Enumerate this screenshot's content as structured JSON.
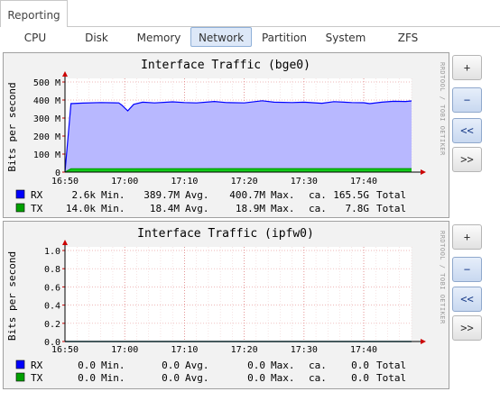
{
  "top_tab": {
    "label": "Reporting"
  },
  "subtabs": [
    {
      "label": "CPU",
      "active": false
    },
    {
      "label": "Disk",
      "active": false
    },
    {
      "label": "Memory",
      "active": false
    },
    {
      "label": "Network",
      "active": true
    },
    {
      "label": "Partition",
      "active": false
    },
    {
      "label": "System",
      "active": false
    },
    {
      "label": "ZFS",
      "active": false
    }
  ],
  "side_buttons": {
    "zoom_in": "+",
    "zoom_out": "−",
    "back": "<<",
    "forward": ">>"
  },
  "chart_data": [
    {
      "type": "area",
      "title": "Interface Traffic (bge0)",
      "ylabel": "Bits per second",
      "watermark": "RRDTOOL / TOBI OETIKER",
      "x_ticks": [
        "16:50",
        "17:00",
        "17:10",
        "17:20",
        "17:30",
        "17:40"
      ],
      "y_ticks": [
        "0",
        "100 M",
        "200 M",
        "300 M",
        "400 M",
        "500 M"
      ],
      "ylim": [
        0,
        500
      ],
      "y_unit": "M",
      "time_range": [
        "16:50",
        "17:48"
      ],
      "series": [
        {
          "name": "RX",
          "color": "#0000ff",
          "fill": "#b8b8ff",
          "x": [
            "16:50",
            "16:51",
            "16:53",
            "16:56",
            "16:59",
            "16:59:30",
            "17:00:30",
            "17:01:30",
            "17:03",
            "17:05",
            "17:08",
            "17:10",
            "17:12",
            "17:15",
            "17:17",
            "17:20",
            "17:23",
            "17:25",
            "17:28",
            "17:30",
            "17:33",
            "17:35",
            "17:38",
            "17:40",
            "17:41",
            "17:43",
            "17:45",
            "17:47",
            "17:48"
          ],
          "values": [
            0,
            380,
            383,
            386,
            384,
            372,
            340,
            376,
            388,
            384,
            390,
            386,
            384,
            392,
            386,
            384,
            396,
            388,
            386,
            388,
            382,
            391,
            386,
            385,
            380,
            388,
            393,
            392,
            395
          ],
          "stats": {
            "min": "2.6k",
            "avg": "389.7M",
            "max": "400.7M",
            "total": "165.5G"
          }
        },
        {
          "name": "TX",
          "color": "#00a000",
          "fill": "#00cc00",
          "x": [
            "16:50",
            "16:51",
            "17:48"
          ],
          "values": [
            0,
            18.4,
            18.9
          ],
          "stats": {
            "min": "14.0k",
            "avg": "18.4M",
            "max": "18.9M",
            "total": "7.8G"
          }
        }
      ]
    },
    {
      "type": "area",
      "title": "Interface Traffic (ipfw0)",
      "ylabel": "Bits per second",
      "watermark": "RRDTOOL / TOBI OETIKER",
      "x_ticks": [
        "16:50",
        "17:00",
        "17:10",
        "17:20",
        "17:30",
        "17:40"
      ],
      "y_ticks": [
        "0.0",
        "0.2",
        "0.4",
        "0.6",
        "0.8",
        "1.0"
      ],
      "ylim": [
        0,
        1
      ],
      "time_range": [
        "16:50",
        "17:48"
      ],
      "series": [
        {
          "name": "RX",
          "color": "#0000ff",
          "fill": "#b8b8ff",
          "x": [
            "16:50",
            "17:48"
          ],
          "values": [
            0,
            0
          ],
          "stats": {
            "min": "0.0",
            "avg": "0.0",
            "max": "0.0",
            "total": "0.0"
          }
        },
        {
          "name": "TX",
          "color": "#00a000",
          "fill": "#00cc00",
          "x": [
            "16:50",
            "17:48"
          ],
          "values": [
            0,
            0
          ],
          "stats": {
            "min": "0.0",
            "avg": "0.0",
            "max": "0.0",
            "total": "0.0"
          }
        }
      ]
    }
  ],
  "legend_words": {
    "min": "Min.",
    "avg": "Avg.",
    "max": "Max.",
    "ca": "ca.",
    "total": "Total"
  }
}
